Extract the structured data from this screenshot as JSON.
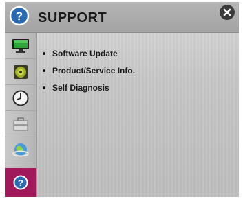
{
  "title": "SUPPORT",
  "sidebar": {
    "items": [
      {
        "name": "picture",
        "icon": "tv-icon"
      },
      {
        "name": "sound",
        "icon": "speaker-icon"
      },
      {
        "name": "time",
        "icon": "clock-icon"
      },
      {
        "name": "lock",
        "icon": "briefcase-icon"
      },
      {
        "name": "network",
        "icon": "globe-icon"
      },
      {
        "name": "support",
        "icon": "help-icon"
      }
    ]
  },
  "menu": {
    "items": [
      {
        "label": "Software Update"
      },
      {
        "label": "Product/Service Info."
      },
      {
        "label": "Self Diagnosis"
      }
    ]
  },
  "colors": {
    "accent": "#a0195b",
    "help_icon": "#2a6ab0"
  }
}
